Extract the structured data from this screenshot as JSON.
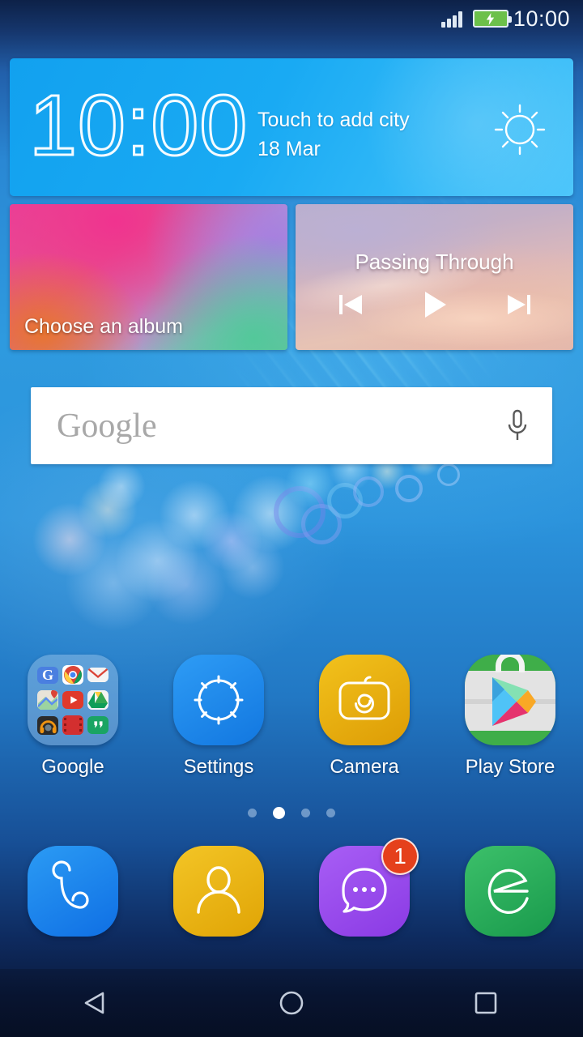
{
  "status_bar": {
    "time": "10:00",
    "signal_icon": "signal-bars-icon",
    "battery_icon": "battery-charging-icon",
    "battery_color": "#6cc04a"
  },
  "clock_widget": {
    "time": "10:00",
    "city_hint": "Touch to add city",
    "date": "18 Mar",
    "weather_icon": "sun-icon",
    "background_color": "#19aaf3"
  },
  "photo_widget": {
    "label": "Choose an album"
  },
  "music_widget": {
    "title": "Passing Through",
    "controls": [
      {
        "name": "previous-track-button",
        "icon": "skip-previous-icon"
      },
      {
        "name": "play-button",
        "icon": "play-icon"
      },
      {
        "name": "next-track-button",
        "icon": "skip-next-icon"
      }
    ]
  },
  "search": {
    "brand": "Google",
    "mic_icon": "microphone-icon"
  },
  "apps": [
    {
      "label": "Google",
      "type": "folder",
      "icon": "google-folder-icon",
      "mini_icons": [
        {
          "name": "google-search-mini-icon",
          "glyph": "G",
          "bg": "#4a7fe0",
          "fg": "#ffffff"
        },
        {
          "name": "chrome-mini-icon",
          "glyph": "",
          "bg": "#ffffff",
          "fg": "#1a73e8"
        },
        {
          "name": "gmail-mini-icon",
          "glyph": "",
          "bg": "#f5f5f5",
          "fg": "#d93025"
        },
        {
          "name": "maps-mini-icon",
          "glyph": "",
          "bg": "#e9e5dd",
          "fg": "#db4437"
        },
        {
          "name": "youtube-mini-icon",
          "glyph": "",
          "bg": "#e0392b",
          "fg": "#ffffff"
        },
        {
          "name": "drive-mini-icon",
          "glyph": "",
          "bg": "#f5f5f5",
          "fg": "#0f9d58"
        },
        {
          "name": "play-music-mini-icon",
          "glyph": "",
          "bg": "#2b2b2b",
          "fg": "#ef9412"
        },
        {
          "name": "play-movies-mini-icon",
          "glyph": "",
          "bg": "#d32f2f",
          "fg": "#ffffff"
        },
        {
          "name": "hangouts-mini-icon",
          "glyph": "",
          "bg": "#1aa463",
          "fg": "#ffffff"
        }
      ]
    },
    {
      "label": "Settings",
      "type": "app",
      "icon": "settings-gear-icon",
      "bg": "#1f8ef1"
    },
    {
      "label": "Camera",
      "type": "app",
      "icon": "camera-icon",
      "bg": "#e8b113"
    },
    {
      "label": "Play Store",
      "type": "app",
      "icon": "play-store-icon",
      "bg": "#e8e8e8"
    }
  ],
  "page_indicator": {
    "count": 4,
    "active_index": 1
  },
  "dock": [
    {
      "name": "phone",
      "icon": "phone-icon",
      "bg": "#1683f0",
      "badge": null
    },
    {
      "name": "contacts",
      "icon": "person-icon",
      "bg": "#e8b113",
      "badge": null
    },
    {
      "name": "messaging",
      "icon": "message-bubble-icon",
      "bg": "#9b4ded",
      "badge": "1"
    },
    {
      "name": "browser",
      "icon": "browser-e-icon",
      "bg": "#25a95a",
      "badge": null
    }
  ],
  "nav_bar": [
    {
      "name": "back-button",
      "icon": "back-triangle-icon"
    },
    {
      "name": "home-button",
      "icon": "home-circle-icon"
    },
    {
      "name": "recents-button",
      "icon": "recents-square-icon"
    }
  ]
}
